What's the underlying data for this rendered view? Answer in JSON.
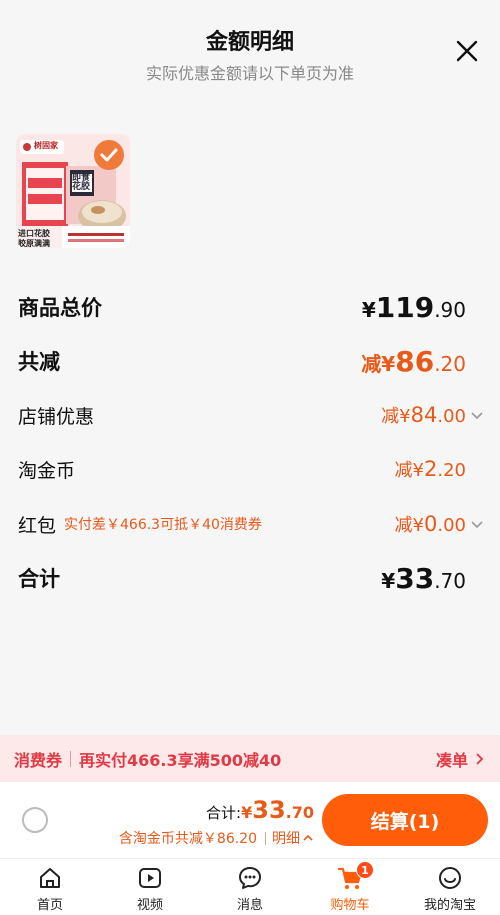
{
  "header": {
    "title": "金额明细",
    "subtitle": "实际优惠金额请以下单页为准"
  },
  "product": {
    "brand": "树固家",
    "name_tag": "即食花胶",
    "badge_line1": "进口花胶",
    "badge_line2": "胶原满满",
    "selected": true
  },
  "rows": {
    "subtotal": {
      "label": "商品总价",
      "symbol": "¥",
      "int": "119",
      "dec": ".90"
    },
    "total_reduce": {
      "label": "共减",
      "prefix": "减¥",
      "int": "86",
      "dec": ".20"
    },
    "store_discount": {
      "label": "店铺优惠",
      "prefix": "减¥",
      "int": "84",
      "dec": ".00"
    },
    "tao_coin": {
      "label": "淘金币",
      "prefix": "减¥",
      "int": "2",
      "dec": ".20"
    },
    "red_packet": {
      "label": "红包",
      "note": "实付差￥466.3可抵￥40消费券",
      "prefix": "减¥",
      "int": "0",
      "dec": ".00"
    },
    "total": {
      "label": "合计",
      "symbol": "¥",
      "int": "33",
      "dec": ".70"
    }
  },
  "promo": {
    "tag": "消费券",
    "text": "再实付466.3享满500减40",
    "link": "凑单"
  },
  "checkout": {
    "total_label": "合计:",
    "total_symbol": "¥",
    "total_int": "33",
    "total_dec": ".70",
    "savings_text": "含淘金币共减￥86.20",
    "detail_label": "明细",
    "pay_label": "结算(1)"
  },
  "tabs": [
    {
      "label": "首页",
      "icon": "home-icon"
    },
    {
      "label": "视频",
      "icon": "video-icon"
    },
    {
      "label": "消息",
      "icon": "message-icon"
    },
    {
      "label": "购物车",
      "icon": "cart-icon",
      "badge": "1",
      "active": true
    },
    {
      "label": "我的淘宝",
      "icon": "profile-icon"
    }
  ],
  "colors": {
    "accent": "#ff5d0a",
    "discount": "#e85a1a",
    "promo": "#e03a45",
    "promo_bg": "#fde8ea"
  }
}
